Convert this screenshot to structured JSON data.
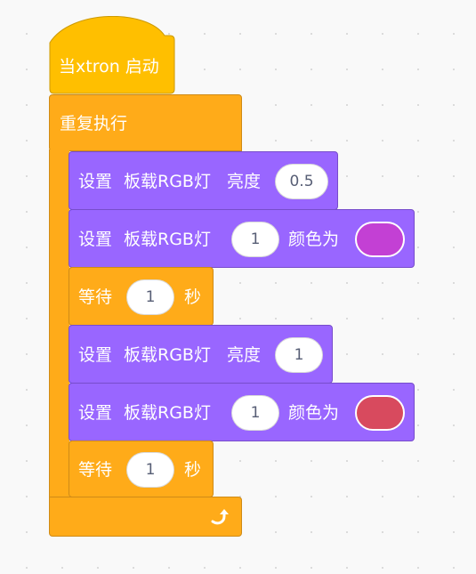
{
  "hat": {
    "label": "当xtron 启动"
  },
  "loop": {
    "label": "重复执行"
  },
  "blocks": [
    {
      "kind": "brightness",
      "set": "设置",
      "target": "板载RGB灯",
      "prop": "亮度",
      "value": "0.5"
    },
    {
      "kind": "color",
      "set": "设置",
      "target": "板载RGB灯",
      "index": "1",
      "prop": "颜色为",
      "color": "#c340d4"
    },
    {
      "kind": "wait",
      "label": "等待",
      "value": "1",
      "unit": "秒"
    },
    {
      "kind": "brightness",
      "set": "设置",
      "target": "板载RGB灯",
      "prop": "亮度",
      "value": "1"
    },
    {
      "kind": "color",
      "set": "设置",
      "target": "板载RGB灯",
      "index": "1",
      "prop": "颜色为",
      "color": "#d84a5e"
    },
    {
      "kind": "wait",
      "label": "等待",
      "value": "1",
      "unit": "秒"
    }
  ],
  "loop_end": {
    "icon": "loop-arrow-icon"
  },
  "colors": {
    "event": "#ffbf00",
    "control": "#ffab19",
    "looks": "#9966ff",
    "background": "#f9f9f9"
  }
}
